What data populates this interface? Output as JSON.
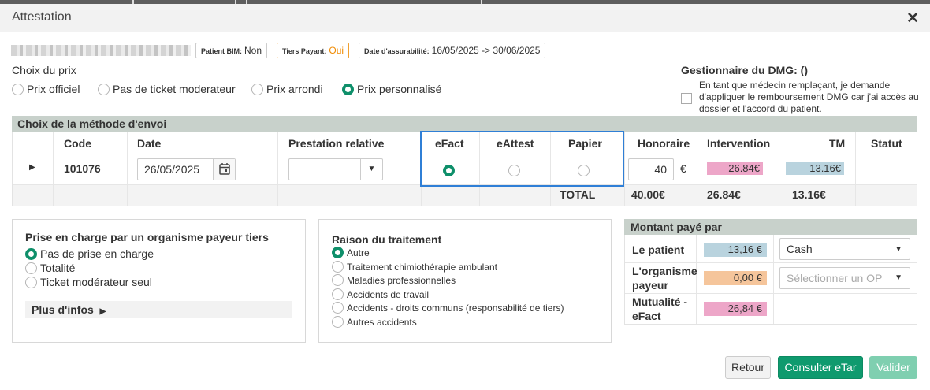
{
  "window": {
    "title": "Attestation",
    "close_icon": "close-icon"
  },
  "patient": {
    "bim_label": "Patient BIM:",
    "bim_value": "Non",
    "tiers_label": "Tiers Payant:",
    "tiers_value": "Oui",
    "assurabilite_label": "Date d'assurabilité:",
    "assurabilite_value": "16/05/2025 -> 30/06/2025"
  },
  "prix": {
    "title": "Choix du prix",
    "options": [
      {
        "label": "Prix officiel",
        "selected": false
      },
      {
        "label": "Pas de ticket moderateur",
        "selected": false
      },
      {
        "label": "Prix arrondi",
        "selected": false
      },
      {
        "label": "Prix personnalisé",
        "selected": true
      }
    ]
  },
  "dmg": {
    "title": "Gestionnaire du DMG: ()",
    "text": "En tant que médecin remplaçant, je demande d'appliquer le remboursement DMG car j'ai accès au dossier et l'accord du patient.",
    "checked": false
  },
  "envoi": {
    "title": "Choix de la méthode d'envoi",
    "headers": [
      "Code",
      "Date",
      "Prestation relative",
      "eFact",
      "eAttest",
      "Papier",
      "Honoraire",
      "Intervention",
      "TM",
      "Statut"
    ],
    "row": {
      "code": "101076",
      "date": "26/05/2025",
      "prestation": "",
      "method": "eFact",
      "honoraire": "40",
      "currency": "€",
      "intervention": "26.84€",
      "tm": "13.16€",
      "statut": ""
    },
    "totals": {
      "label": "TOTAL",
      "honoraire": "40.00€",
      "intervention": "26.84€",
      "tm": "13.16€"
    }
  },
  "prise_en_charge": {
    "title": "Prise en charge par un organisme payeur tiers",
    "options": [
      {
        "label": "Pas de prise en charge",
        "selected": true
      },
      {
        "label": "Totalité",
        "selected": false
      },
      {
        "label": "Ticket modérateur seul",
        "selected": false
      }
    ],
    "more_label": "Plus d'infos"
  },
  "raison": {
    "title": "Raison du traitement",
    "options": [
      {
        "label": "Autre",
        "selected": true
      },
      {
        "label": "Traitement chimiothérapie ambulant",
        "selected": false
      },
      {
        "label": "Maladies professionnelles",
        "selected": false
      },
      {
        "label": "Accidents de travail",
        "selected": false
      },
      {
        "label": "Accidents - droits communs (responsabilité de tiers)",
        "selected": false
      },
      {
        "label": "Autres accidents",
        "selected": false
      }
    ]
  },
  "montant": {
    "title": "Montant payé par",
    "rows": [
      {
        "label": "Le patient",
        "amount": "13,16 €",
        "select": "Cash"
      },
      {
        "label": "L'organisme payeur",
        "amount": "0,00 €",
        "select_placeholder": "Sélectionner un OP"
      },
      {
        "label": "Mutualité - eFact",
        "amount": "26,84 €"
      }
    ]
  },
  "buttons": {
    "retour": "Retour",
    "etar": "Consulter eTar",
    "valider": "Valider"
  },
  "colors": {
    "accent": "#0f9a6e",
    "header_bar": "#c8d1cb",
    "chip_blue": "#b9d3de",
    "chip_pink": "#eda6c8",
    "chip_orange": "#f5c59b",
    "highlight_frame": "#2f7fd6"
  }
}
